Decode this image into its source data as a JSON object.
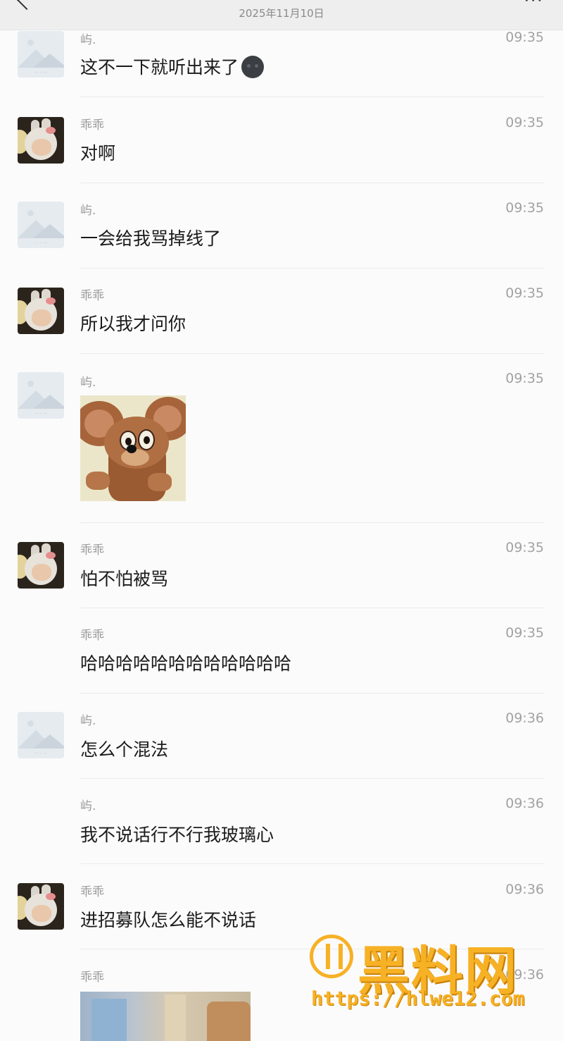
{
  "header": {
    "title": "",
    "date": "2025年11月10日",
    "more_label": "···"
  },
  "messages": [
    {
      "sender": "屿.",
      "time": "09:35",
      "text": "这不一下就听出来了",
      "emoji": "new-moon-face-emoji"
    },
    {
      "sender": "乖乖",
      "time": "09:35",
      "text": "对啊"
    },
    {
      "sender": "屿.",
      "time": "09:35",
      "text": "一会给我骂掉线了"
    },
    {
      "sender": "乖乖",
      "time": "09:35",
      "text": "所以我才问你"
    },
    {
      "sender": "屿.",
      "time": "09:35",
      "sticker": "jerry-mouse-sticker"
    },
    {
      "sender": "乖乖",
      "time": "09:35",
      "text": "怕不怕被骂"
    },
    {
      "sender": "乖乖",
      "time": "09:35",
      "text": "哈哈哈哈哈哈哈哈哈哈哈哈"
    },
    {
      "sender": "屿.",
      "time": "09:36",
      "text": "怎么个混法"
    },
    {
      "sender": "屿.",
      "time": "09:36",
      "text": "我不说话行不行我玻璃心"
    },
    {
      "sender": "乖乖",
      "time": "09:36",
      "text": "进招募队怎么能不说话"
    },
    {
      "sender": "乖乖",
      "time": "09:36",
      "photo": "room-photo"
    }
  ],
  "watermark": {
    "brand": "黑料网",
    "url": "https://hlwe12.com"
  },
  "colors": {
    "background": "#fbfbfb",
    "header": "#eeeeee",
    "watermark": "#f7b125"
  }
}
